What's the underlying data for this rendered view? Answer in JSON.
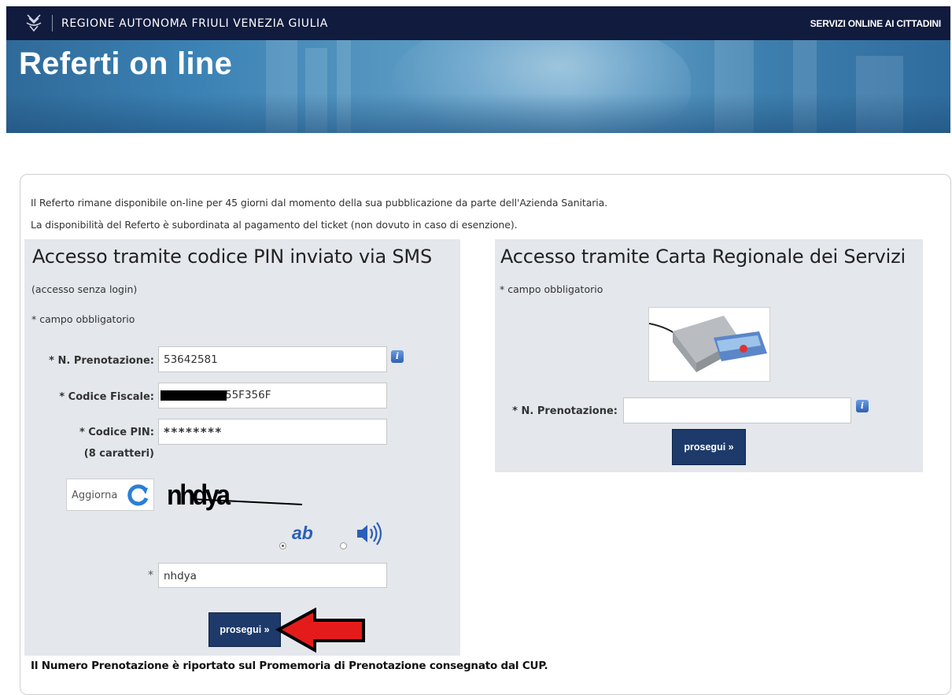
{
  "header": {
    "region": "REGIONE AUTONOMA FRIULI VENEZIA GIULIA",
    "services": "SERVIZI ONLINE AI CITTADINI",
    "logo_icon": "region-crest-icon"
  },
  "banner": {
    "title": "Referti on line"
  },
  "intro": {
    "line1": "Il Referto rimane disponibile on-line per 45 giorni dal momento della sua pubblicazione da parte dell'Azienda Sanitaria.",
    "line2": "La disponibilità del Referto è subordinata al pagamento del ticket (non dovuto in caso di esenzione)."
  },
  "pin_access": {
    "title": "Accesso tramite codice PIN inviato via SMS",
    "no_login": "(accesso senza login)",
    "required_note": "* campo obbligatorio",
    "prenotazione_label": "* N. Prenotazione:",
    "prenotazione_value": "53642581",
    "codice_fiscale_label": "* Codice Fiscale:",
    "codice_fiscale_value": "55F356F",
    "pin_label": "* Codice PIN:",
    "pin_sublabel": "(8 caratteri)",
    "pin_value": "********",
    "refresh_label": "Aggiorna",
    "captcha_text": "nhdya",
    "captcha_mode_text": "ab",
    "captcha_required_star": "*",
    "captcha_input_value": "nhdya",
    "submit_label": "prosegui »"
  },
  "card_access": {
    "title": "Accesso tramite Carta Regionale dei Servizi",
    "required_note": "* campo obbligatorio",
    "prenotazione_label": "* N. Prenotazione:",
    "prenotazione_value": "",
    "submit_label": "prosegui »"
  },
  "footer_note": "Il Numero Prenotazione è riportato sul Promemoria di Prenotazione consegnato dal CUP.",
  "colors": {
    "topbar": "#101b3d",
    "button": "#1d3a6a",
    "box_bg": "#e4e7ec",
    "arrow": "#e51b1b"
  }
}
